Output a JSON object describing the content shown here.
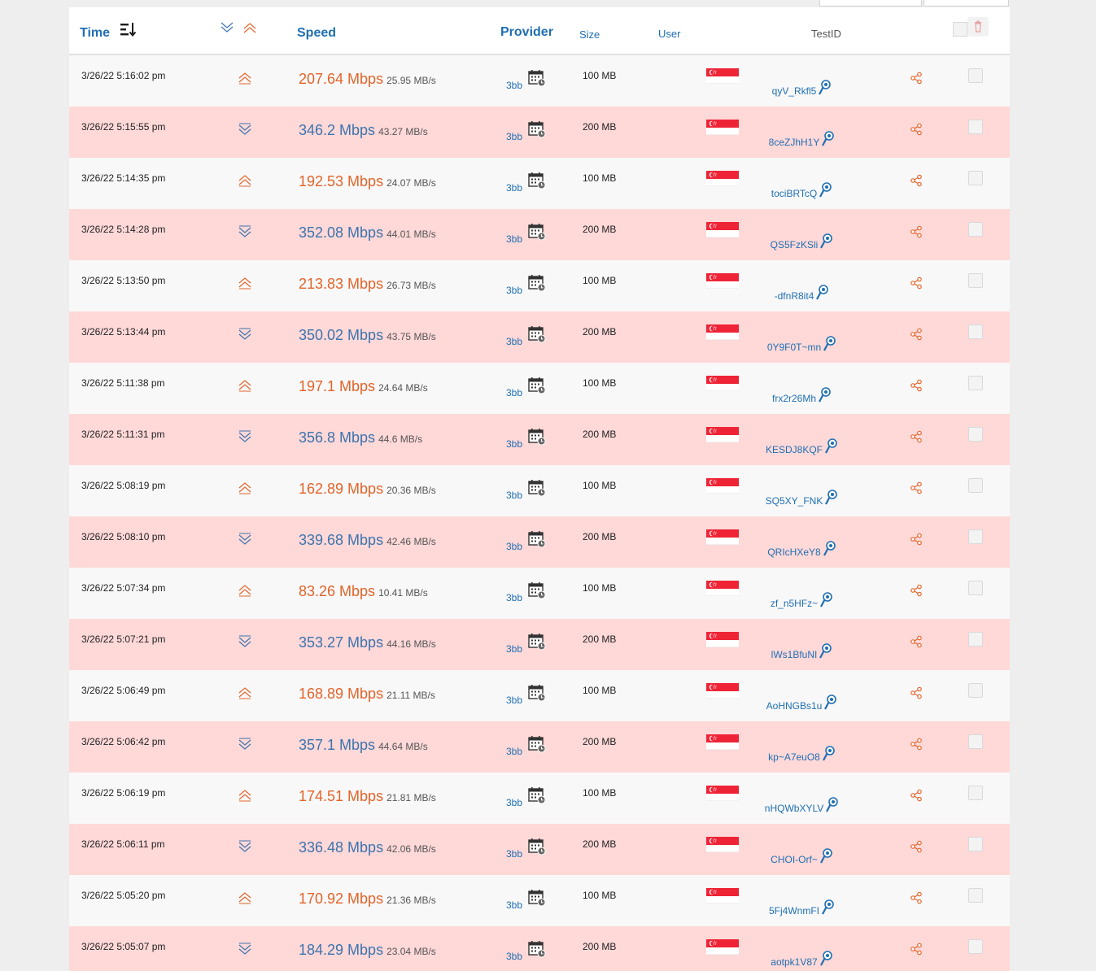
{
  "header": {
    "time": "Time",
    "speed": "Speed",
    "provider": "Provider",
    "size": "Size",
    "user": "User",
    "testid": "TestID"
  },
  "colors": {
    "upload": "#e2642a",
    "download": "#3c74ad",
    "link": "#1f6fb2",
    "row_even": "#ffd8d8",
    "row_odd": "#f8f8f8"
  },
  "rows": [
    {
      "time": "3/26/22 5:16:02 pm",
      "dir": "up",
      "mbps": "207.64 Mbps",
      "mbs": "25.95 MB/s",
      "provider": "3bb",
      "size": "100 MB",
      "testid": "qyV_Rkfl5"
    },
    {
      "time": "3/26/22 5:15:55 pm",
      "dir": "down",
      "mbps": "346.2 Mbps",
      "mbs": "43.27 MB/s",
      "provider": "3bb",
      "size": "200 MB",
      "testid": "8ceZJhH1Y"
    },
    {
      "time": "3/26/22 5:14:35 pm",
      "dir": "up",
      "mbps": "192.53 Mbps",
      "mbs": "24.07 MB/s",
      "provider": "3bb",
      "size": "100 MB",
      "testid": "tociBRTcQ"
    },
    {
      "time": "3/26/22 5:14:28 pm",
      "dir": "down",
      "mbps": "352.08 Mbps",
      "mbs": "44.01 MB/s",
      "provider": "3bb",
      "size": "200 MB",
      "testid": "QS5FzKSli"
    },
    {
      "time": "3/26/22 5:13:50 pm",
      "dir": "up",
      "mbps": "213.83 Mbps",
      "mbs": "26.73 MB/s",
      "provider": "3bb",
      "size": "100 MB",
      "testid": "-dfnR8it4"
    },
    {
      "time": "3/26/22 5:13:44 pm",
      "dir": "down",
      "mbps": "350.02 Mbps",
      "mbs": "43.75 MB/s",
      "provider": "3bb",
      "size": "200 MB",
      "testid": "0Y9F0T~mn"
    },
    {
      "time": "3/26/22 5:11:38 pm",
      "dir": "up",
      "mbps": "197.1 Mbps",
      "mbs": "24.64 MB/s",
      "provider": "3bb",
      "size": "100 MB",
      "testid": "frx2r26Mh"
    },
    {
      "time": "3/26/22 5:11:31 pm",
      "dir": "down",
      "mbps": "356.8 Mbps",
      "mbs": "44.6 MB/s",
      "provider": "3bb",
      "size": "200 MB",
      "testid": "KESDJ8KQF"
    },
    {
      "time": "3/26/22 5:08:19 pm",
      "dir": "up",
      "mbps": "162.89 Mbps",
      "mbs": "20.36 MB/s",
      "provider": "3bb",
      "size": "100 MB",
      "testid": "SQ5XY_FNK"
    },
    {
      "time": "3/26/22 5:08:10 pm",
      "dir": "down",
      "mbps": "339.68 Mbps",
      "mbs": "42.46 MB/s",
      "provider": "3bb",
      "size": "200 MB",
      "testid": "QRIcHXeY8"
    },
    {
      "time": "3/26/22 5:07:34 pm",
      "dir": "up",
      "mbps": "83.26 Mbps",
      "mbs": "10.41 MB/s",
      "provider": "3bb",
      "size": "100 MB",
      "testid": "zf_n5HFz~"
    },
    {
      "time": "3/26/22 5:07:21 pm",
      "dir": "down",
      "mbps": "353.27 Mbps",
      "mbs": "44.16 MB/s",
      "provider": "3bb",
      "size": "200 MB",
      "testid": "lWs1BfuNI"
    },
    {
      "time": "3/26/22 5:06:49 pm",
      "dir": "up",
      "mbps": "168.89 Mbps",
      "mbs": "21.11 MB/s",
      "provider": "3bb",
      "size": "100 MB",
      "testid": "AoHNGBs1u"
    },
    {
      "time": "3/26/22 5:06:42 pm",
      "dir": "down",
      "mbps": "357.1 Mbps",
      "mbs": "44.64 MB/s",
      "provider": "3bb",
      "size": "200 MB",
      "testid": "kp~A7euO8"
    },
    {
      "time": "3/26/22 5:06:19 pm",
      "dir": "up",
      "mbps": "174.51 Mbps",
      "mbs": "21.81 MB/s",
      "provider": "3bb",
      "size": "100 MB",
      "testid": "nHQWbXYLV"
    },
    {
      "time": "3/26/22 5:06:11 pm",
      "dir": "down",
      "mbps": "336.48 Mbps",
      "mbs": "42.06 MB/s",
      "provider": "3bb",
      "size": "200 MB",
      "testid": "CHOI-Orf~"
    },
    {
      "time": "3/26/22 5:05:20 pm",
      "dir": "up",
      "mbps": "170.92 Mbps",
      "mbs": "21.36 MB/s",
      "provider": "3bb",
      "size": "100 MB",
      "testid": "5Fj4WnmFI"
    },
    {
      "time": "3/26/22 5:05:07 pm",
      "dir": "down",
      "mbps": "184.29 Mbps",
      "mbs": "23.04 MB/s",
      "provider": "3bb",
      "size": "200 MB",
      "testid": "aotpk1V87"
    }
  ]
}
